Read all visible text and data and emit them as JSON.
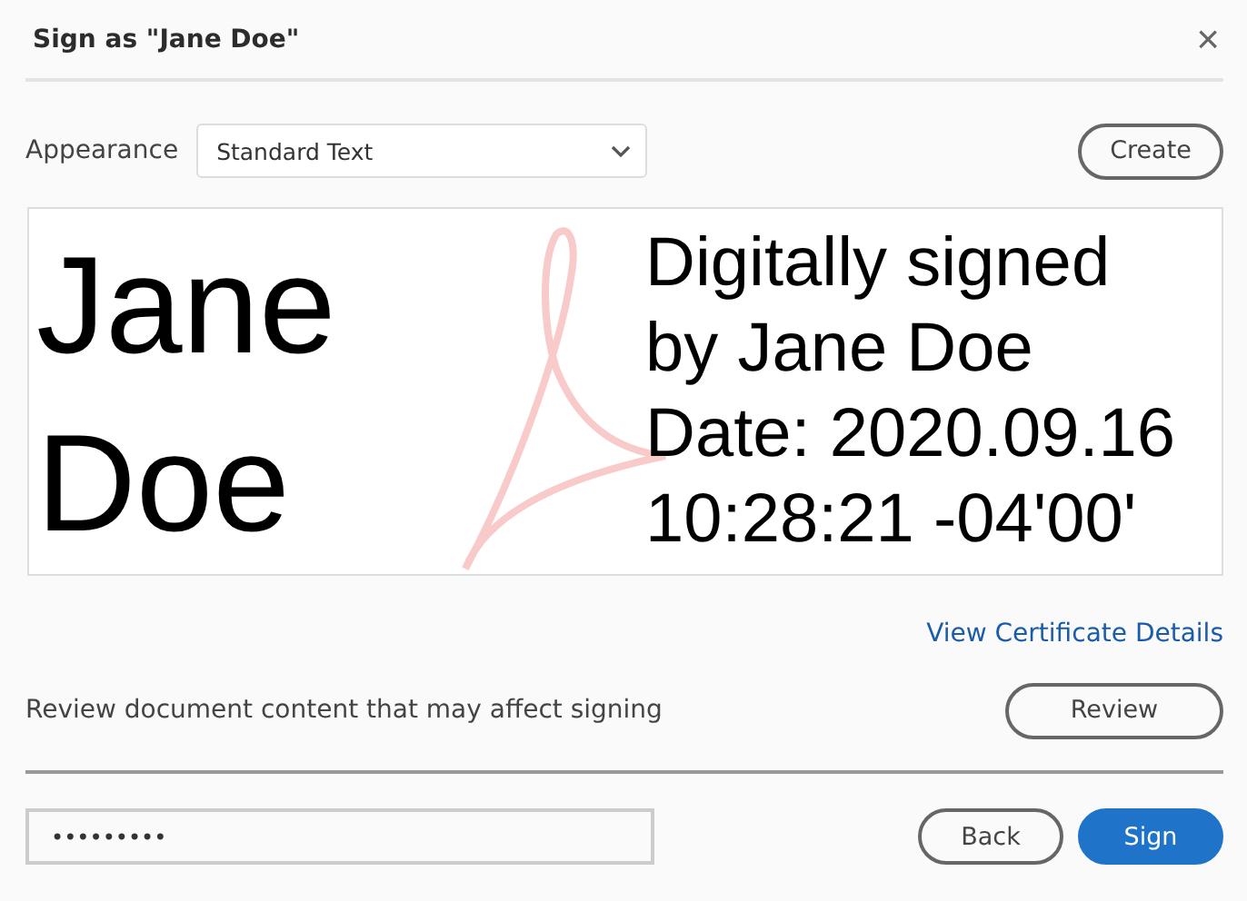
{
  "window": {
    "title": "Sign as \"Jane Doe\"",
    "close": "×"
  },
  "appearance": {
    "label": "Appearance",
    "value": "Standard Text"
  },
  "create_button": "Create",
  "preview": {
    "name_lines": [
      "Jane",
      "Doe"
    ],
    "detail_lines": [
      "Digitally signed",
      "by Jane Doe",
      "Date: 2020.09.16",
      "10:28:21 -04'00'"
    ]
  },
  "certificate_link": "View Certificate Details",
  "review": {
    "text": "Review document content that may affect signing",
    "button": "Review"
  },
  "password": {
    "value": "•••••••••"
  },
  "buttons": [
    {
      "label": "Back",
      "kind": "secondary"
    },
    {
      "label": "Sign",
      "kind": "primary"
    }
  ]
}
